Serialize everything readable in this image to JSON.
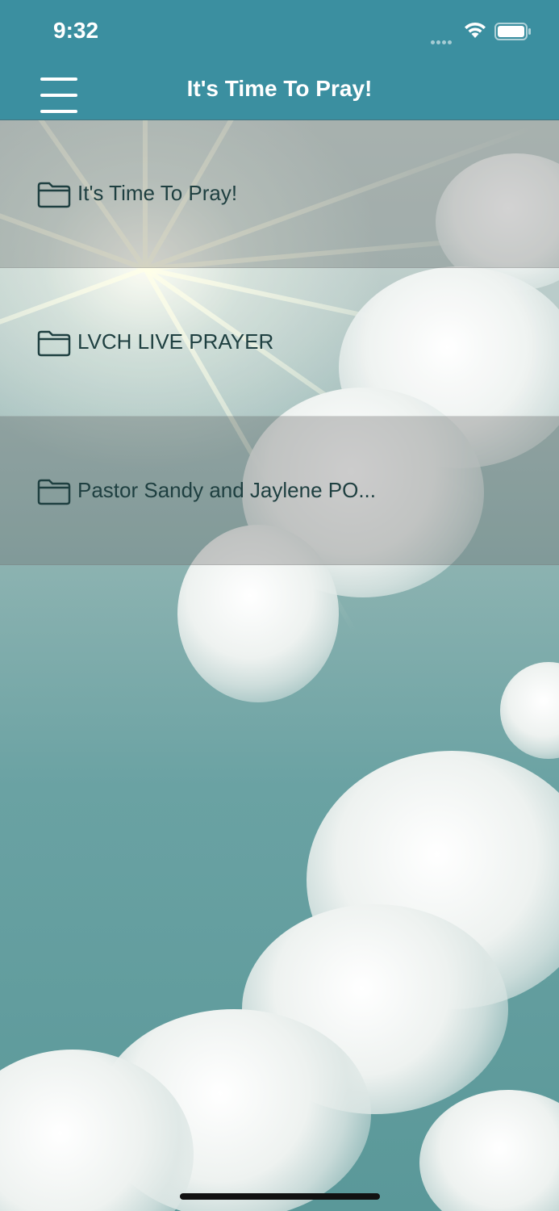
{
  "status_bar": {
    "time": "9:32"
  },
  "header": {
    "title": "It's Time To Pray!",
    "menu_icon": "hamburger-menu-icon"
  },
  "list": {
    "items": [
      {
        "label": "It's Time To Pray!",
        "icon": "folder-icon"
      },
      {
        "label": "LVCH LIVE PRAYER",
        "icon": "folder-icon"
      },
      {
        "label": "Pastor Sandy and Jaylene PO...",
        "icon": "folder-icon"
      }
    ]
  },
  "colors": {
    "accent": "#3b8fa0",
    "label_text": "#1e3f40"
  }
}
